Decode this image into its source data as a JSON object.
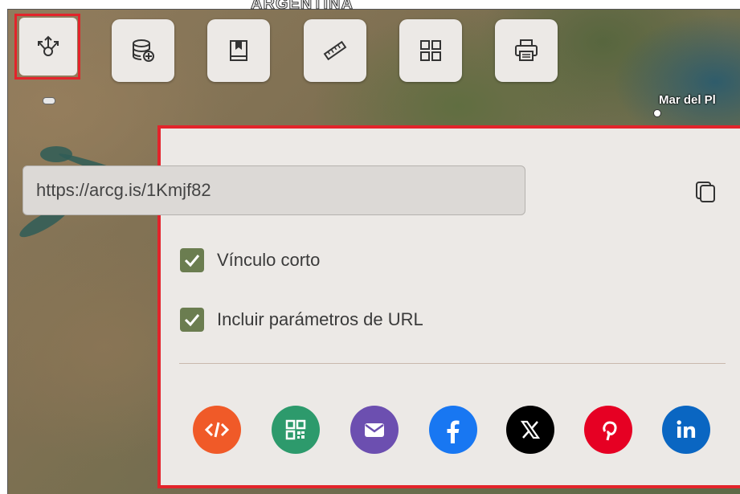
{
  "map": {
    "country_label": "ARGENTINA",
    "city_label": "Mar del Pl"
  },
  "toolbar": {
    "share": {
      "icon": "share-icon",
      "highlight_color": "#e3242b"
    },
    "buttons": [
      {
        "icon": "add-data-icon"
      },
      {
        "icon": "bookmark-icon"
      },
      {
        "icon": "measure-ruler-icon"
      },
      {
        "icon": "grid-icon"
      },
      {
        "icon": "print-icon"
      }
    ]
  },
  "share_panel": {
    "url_value": "https://arcg.is/1Kmjf82",
    "copy_icon": "copy-icon",
    "options": [
      {
        "label": "Vínculo corto",
        "checked": true
      },
      {
        "label": "Incluir parámetros de URL",
        "checked": true
      }
    ],
    "targets": [
      {
        "name": "embed",
        "icon": "code-icon",
        "color": "#f05a28"
      },
      {
        "name": "qr",
        "icon": "qr-code-icon",
        "color": "#2d9a6c"
      },
      {
        "name": "email",
        "icon": "email-icon",
        "color": "#6c4fb0"
      },
      {
        "name": "facebook",
        "icon": "facebook-icon",
        "color": "#1877f2"
      },
      {
        "name": "x",
        "icon": "x-icon",
        "color": "#000000"
      },
      {
        "name": "pinterest",
        "icon": "pinterest-icon",
        "color": "#e60023"
      },
      {
        "name": "linkedin",
        "icon": "linkedin-icon",
        "color": "#0a66c2"
      }
    ],
    "accent_color": "#6b7d50"
  }
}
